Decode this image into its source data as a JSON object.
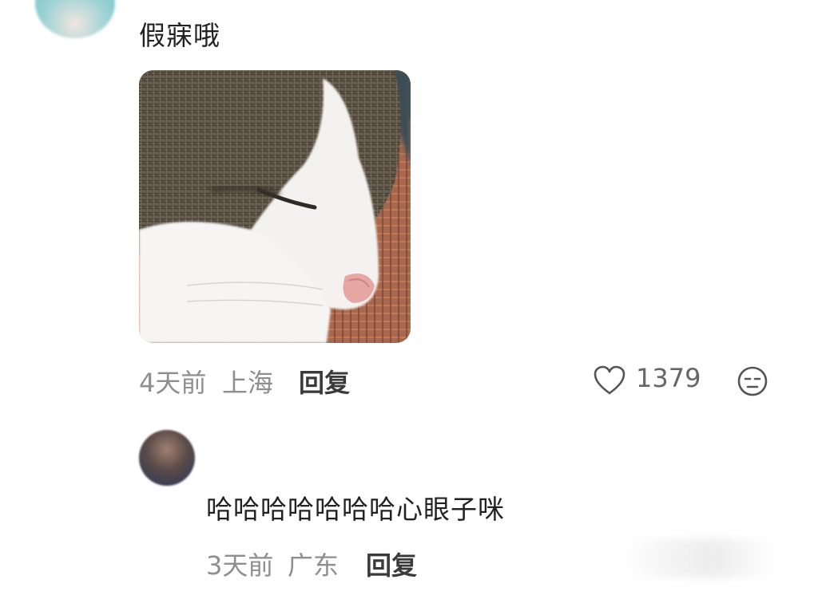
{
  "comment": {
    "text": "假寐哦",
    "time": "4天前",
    "location": "上海",
    "reply_label": "回复",
    "like_count": "1379",
    "like_icon": "heart-outline-icon",
    "emoji_icon": "sleepy-face-icon",
    "image": "photo-sleeping-cat"
  },
  "reply": {
    "text": "哈哈哈哈哈哈哈心眼子咪",
    "time": "3天前",
    "location": "广东",
    "reply_label": "回复"
  },
  "colors": {
    "text_primary": "#222222",
    "text_meta": "#8e8e8e",
    "icon": "#555555",
    "background": "#ffffff"
  }
}
